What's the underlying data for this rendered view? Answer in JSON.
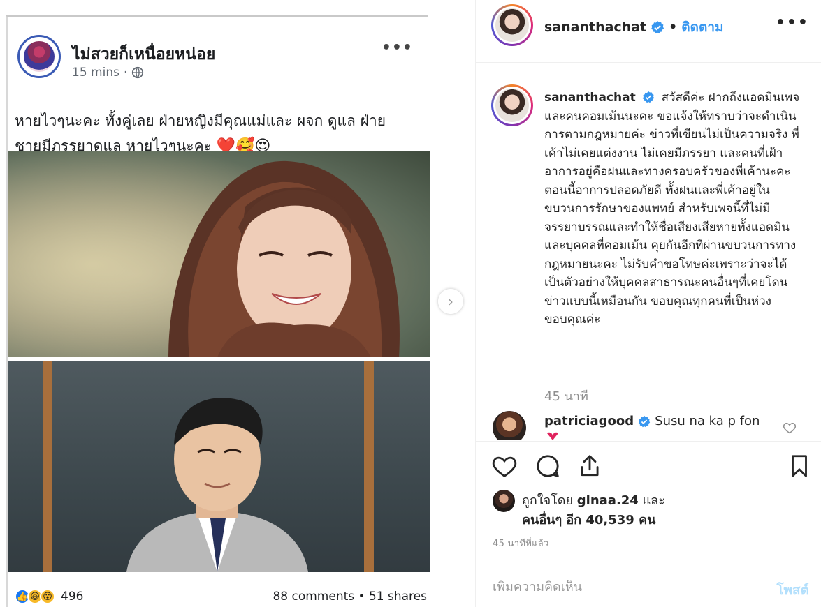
{
  "fb_post": {
    "page_name": "ไม่สวยก็เหนื่อยหน่อย",
    "time": "15 mins",
    "time_sep": "·",
    "more": "•••",
    "text_line1": "หายไวๆนะคะ ทั้งคู่เลย ฝ่ายหญิงมีคุณแม่และ ผจก ดูแล ฝ่าย",
    "text_line2": "ชายมีภรรยาดูแล หายไวๆนะคะ",
    "text_emoji": "❤️🥰😍",
    "reaction_icons": [
      "like-icon",
      "haha-icon",
      "wow-icon"
    ],
    "reaction_count": "496",
    "comments": "88 comments",
    "stats_sep": "•",
    "shares": "51 shares"
  },
  "carousel": {
    "next_icon": "chevron-right-icon",
    "next_glyph": "›"
  },
  "header": {
    "username": "sananthachat",
    "separator": "•",
    "follow_label": "ติดตาม",
    "more": "•••"
  },
  "caption": {
    "username": "sananthachat",
    "text": "สวัสดีค่ะ ฝากถึงแอดมินเพจและคนคอมเม้นนะคะ ขอแจ้งให้ทราบว่าจะดำเนินการตามกฎหมายค่ะ ข่าวที่เขียนไม่เป็นความจริง พี่เค้าไม่เคยแต่งงาน ไม่เคยมีภรรยา และคนที่เฝ้าอาการอยู่คือฝนและทางครอบครัวของพี่เค้านะคะ ตอนนี้อาการปลอดภัยดี ทั้งฝนและพี่เค้าอยู่ในขบวนการรักษาของแพทย์ สำหรับเพจนี้ที่ไม่มีจรรยาบรรณและทำให้ชื่อเสียงเสียหายทั้งแอดมินและบุคคลที่คอมเม้น คุยกันอีกทีผ่านขบวนการทางกฎหมายนะคะ ไม่รับคำขอโทษค่ะเพราะว่าจะได้เป็นตัวอย่างให้บุคคลสาธารณะคนอื่นๆที่เคยโดนข่าวแบบนี้เหมือนกัน ขอบคุณทุกคนที่เป็นห่วง ขอบคุณค่ะ",
    "time": "45 นาที"
  },
  "comment": {
    "username": "patriciagood",
    "text": "Susu na ka p fon"
  },
  "likes": {
    "prefix": "ถูกใจโดย",
    "liker": "ginaa.24",
    "and": "และ",
    "others": "คนอื่นๆ อีก 40,539 คน"
  },
  "post_time": "45 นาทีที่แล้ว",
  "add_comment": {
    "placeholder": "เพิ่มความคิดเห็น",
    "post_label": "โพสต์"
  },
  "colors": {
    "accent": "#3897f0",
    "verified": "#3897f0",
    "post_disabled": "#b2dffc",
    "muted": "#8e8e8e"
  }
}
